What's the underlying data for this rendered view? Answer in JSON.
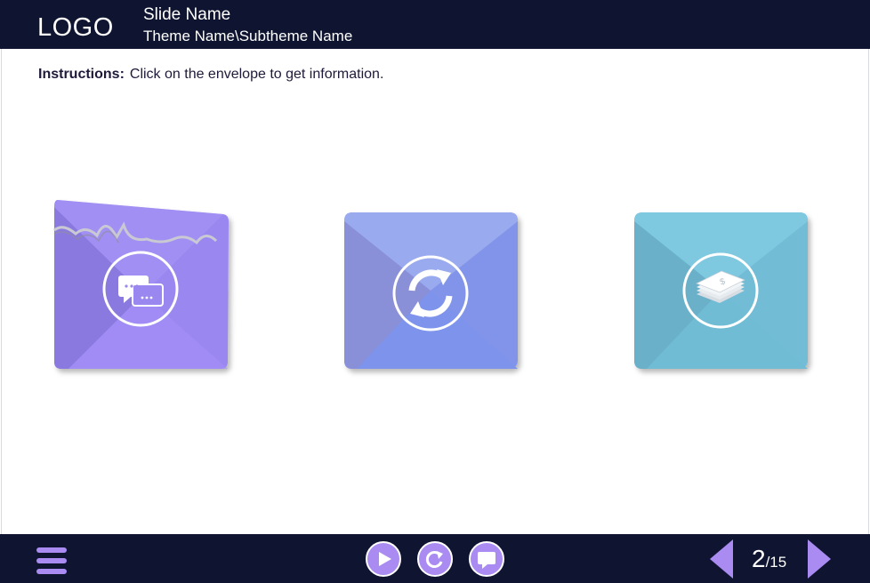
{
  "header": {
    "logo": "LOGO",
    "slide_name": "Slide Name",
    "theme_name": "Theme Name\\Subtheme Name"
  },
  "instructions": {
    "label": "Instructions:",
    "text": "Click on the envelope to get information."
  },
  "envelopes": [
    {
      "name": "chat",
      "icon": "chat-bubbles-icon",
      "state": "opened",
      "color": "#9b87f0"
    },
    {
      "name": "refresh",
      "icon": "refresh-arrows-icon",
      "state": "closed",
      "color": "#8294ea"
    },
    {
      "name": "money",
      "icon": "money-stack-icon",
      "state": "closed",
      "color": "#72bcd6"
    }
  ],
  "footer": {
    "menu_icon": "hamburger-menu-icon",
    "buttons": [
      "play-icon",
      "replay-icon",
      "comment-icon"
    ],
    "page_current": "2",
    "page_total": "/15"
  },
  "colors": {
    "bar": "#0f1530",
    "accent": "#a98bf2"
  }
}
